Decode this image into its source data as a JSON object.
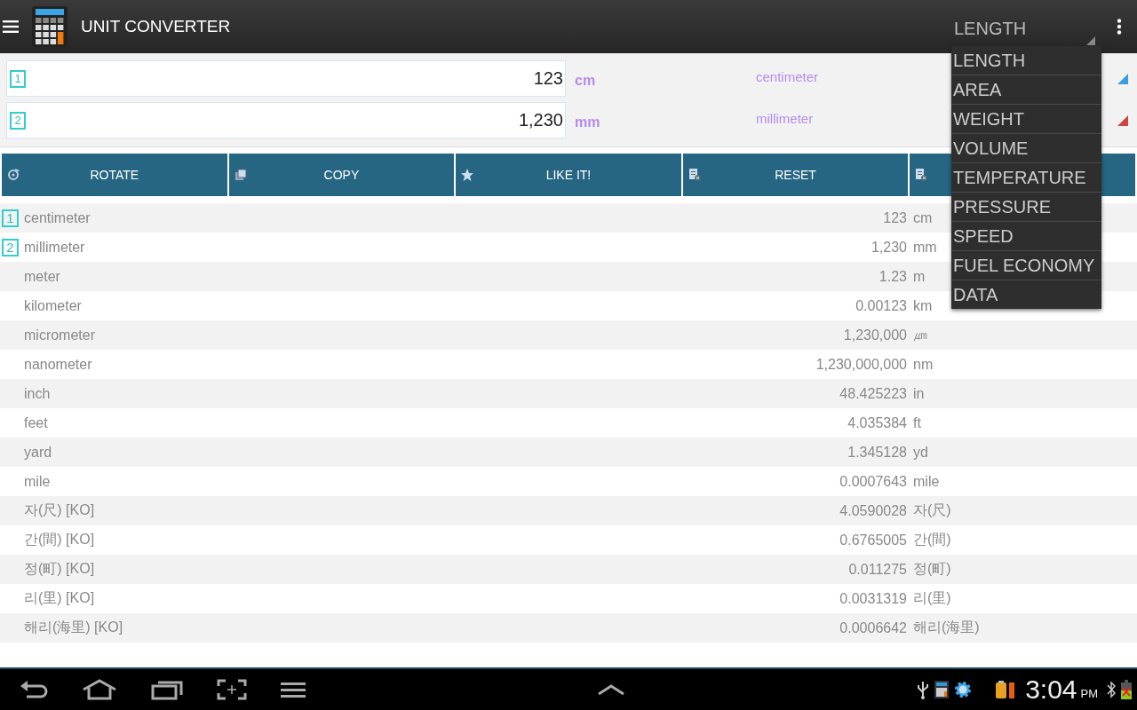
{
  "app_bar": {
    "title": "UNIT CONVERTER",
    "category": "LENGTH"
  },
  "category_menu": [
    {
      "label": "LENGTH"
    },
    {
      "label": "AREA"
    },
    {
      "label": "WEIGHT"
    },
    {
      "label": "VOLUME"
    },
    {
      "label": "TEMPERATURE"
    },
    {
      "label": "PRESSURE"
    },
    {
      "label": "SPEED"
    },
    {
      "label": "FUEL ECONOMY"
    },
    {
      "label": "DATA"
    }
  ],
  "inputs": [
    {
      "badge": "1",
      "value": "123",
      "unit": "cm",
      "unit_name": "centimeter",
      "color": "#3d9be0"
    },
    {
      "badge": "2",
      "value": "1,230",
      "unit": "mm",
      "unit_name": "millimeter",
      "color": "#cc4444"
    }
  ],
  "buttons": [
    {
      "kind": "rotate",
      "label": "ROTATE"
    },
    {
      "kind": "copy",
      "label": "COPY"
    },
    {
      "kind": "like",
      "label": "LIKE IT!"
    },
    {
      "kind": "reset",
      "label": "RESET"
    },
    {
      "kind": "reset"
    }
  ],
  "rows": [
    {
      "badge": "1",
      "name": "centimeter",
      "value": "123",
      "unit": "cm"
    },
    {
      "badge": "2",
      "name": "millimeter",
      "value": "1,230",
      "unit": "mm"
    },
    {
      "name": "meter",
      "value": "1.23",
      "unit": "m"
    },
    {
      "name": "kilometer",
      "value": "0.00123",
      "unit": "km"
    },
    {
      "name": "micrometer",
      "value": "1,230,000",
      "unit": "㎛"
    },
    {
      "name": "nanometer",
      "value": "1,230,000,000",
      "unit": "nm"
    },
    {
      "name": "inch",
      "value": "48.425223",
      "unit": "in"
    },
    {
      "name": "feet",
      "value": "4.035384",
      "unit": "ft"
    },
    {
      "name": "yard",
      "value": "1.345128",
      "unit": "yd"
    },
    {
      "name": "mile",
      "value": "0.0007643",
      "unit": "mile"
    },
    {
      "name": "자(尺) [KO]",
      "value": "4.0590028",
      "unit": "자(尺)"
    },
    {
      "name": "간(間) [KO]",
      "value": "0.6765005",
      "unit": "간(間)"
    },
    {
      "name": "정(町) [KO]",
      "value": "0.011275",
      "unit": "정(町)"
    },
    {
      "name": "리(里) [KO]",
      "value": "0.0031319",
      "unit": "리(里)"
    },
    {
      "name": "해리(海里) [KO]",
      "value": "0.0006642",
      "unit": "해리(海里)"
    }
  ],
  "status_bar": {
    "time": "3:04",
    "ampm": "PM"
  }
}
